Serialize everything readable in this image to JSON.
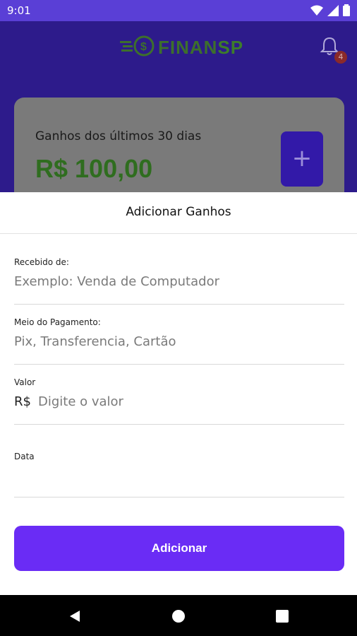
{
  "status_bar": {
    "time": "9:01",
    "icons": [
      "wifi-icon",
      "signal-icon",
      "battery-icon"
    ]
  },
  "app": {
    "logo": {
      "text": "FINAN",
      "accent": "SP"
    },
    "notifications": {
      "count": "4"
    }
  },
  "summary_card": {
    "label": "Ganhos dos últimos 30 dias",
    "amount": "R$ 100,00",
    "add_symbol": "+"
  },
  "sheet": {
    "title": "Adicionar Ganhos",
    "fields": [
      {
        "label": "Recebido de:",
        "placeholder": "Exemplo: Venda de Computador"
      },
      {
        "label": "Meio do Pagamento:",
        "placeholder": "Pix, Transferencia, Cartão"
      },
      {
        "label": "Valor",
        "prefix": "R$",
        "placeholder": "Digite o valor"
      },
      {
        "label": "Data",
        "placeholder": ""
      }
    ],
    "submit_label": "Adicionar"
  },
  "colors": {
    "primary": "#6a2cf5",
    "appbar": "#2d1b8b",
    "accent_green": "#2f6d1f"
  }
}
